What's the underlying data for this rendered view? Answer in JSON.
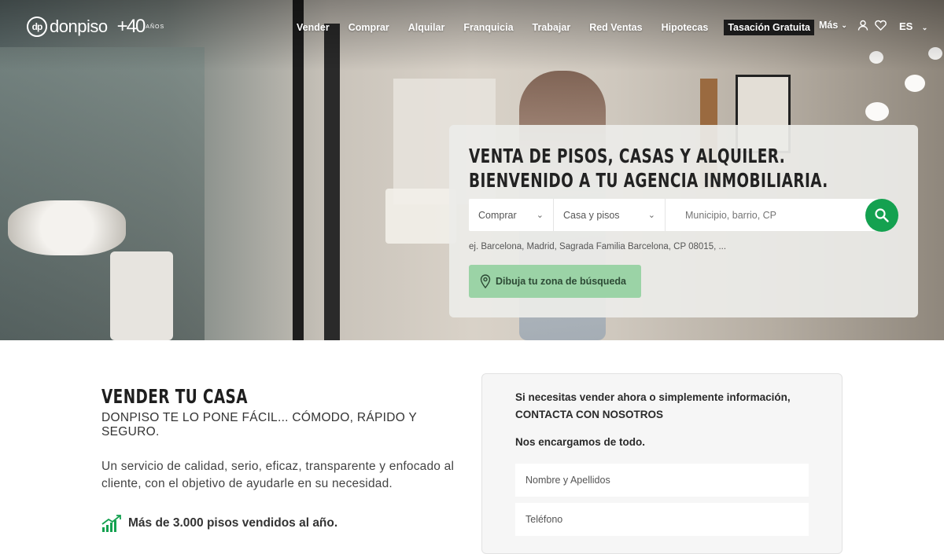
{
  "header": {
    "logo_text": "donpiso",
    "logo_mark": "dp",
    "badge_number": "+40",
    "badge_text": "AÑOS",
    "nav": [
      {
        "label": "Vender"
      },
      {
        "label": "Comprar"
      },
      {
        "label": "Alquilar"
      },
      {
        "label": "Franquicia"
      },
      {
        "label": "Trabajar"
      },
      {
        "label": "Red Ventas"
      },
      {
        "label": "Hipotecas"
      },
      {
        "label": "Tasación Gratuita"
      },
      {
        "label": "Más"
      }
    ],
    "language": "ES",
    "icons": [
      "user-icon",
      "heart-icon"
    ]
  },
  "search": {
    "title_line1": "VENTA DE PISOS, CASAS Y ALQUILER.",
    "title_line2": "BIENVENIDO A TU AGENCIA INMOBILIARIA.",
    "operation": "Comprar",
    "property_type": "Casa y pisos",
    "location_placeholder": "Municipio, barrio, CP",
    "hint": "ej. Barcelona, Madrid, Sagrada Familia Barcelona, CP 08015, ...",
    "draw_zone_label": "Dibuja tu zona de búsqueda"
  },
  "sell": {
    "title": "VENDER TU CASA",
    "subtitle": "DONPISO TE LO PONE FÁCIL... CÓMODO, RÁPIDO Y SEGURO.",
    "description": "Un servicio de calidad, serio, eficaz, transparente y enfocado al cliente, con el objetivo de ayudarle en su necesidad.",
    "stat": "Más de 3.000 pisos vendidos al año."
  },
  "contact": {
    "line1": "Si necesitas vender ahora o simplemente información,",
    "line2": "CONTACTA CON NOSOTROS",
    "line3": "Nos encargamos de todo.",
    "name_placeholder": "Nombre y Apellidos",
    "phone_placeholder": "Teléfono"
  },
  "colors": {
    "accent_green": "#14a150",
    "draw_button_bg": "#9bd3a6"
  }
}
